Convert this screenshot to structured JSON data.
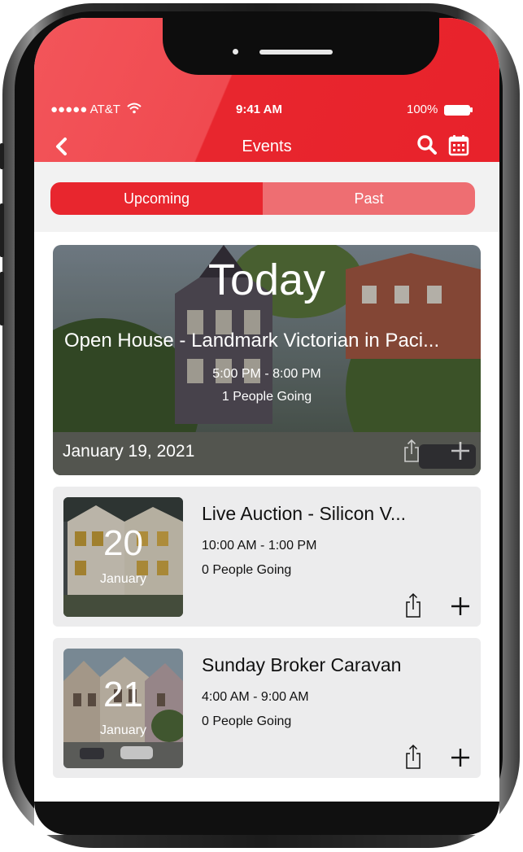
{
  "status_bar": {
    "carrier": "●●●●● AT&T",
    "time": "9:41 AM",
    "battery": "100%"
  },
  "header": {
    "title": "Events",
    "back_icon": "chevron-left-icon",
    "search_icon": "search-icon",
    "calendar_icon": "calendar-icon"
  },
  "tabs": [
    {
      "label": "Upcoming",
      "active": true
    },
    {
      "label": "Past",
      "active": false
    }
  ],
  "featured_event": {
    "heading": "Today",
    "title": "Open House - Landmark Victorian in Paci...",
    "time": "5:00 PM - 8:00 PM",
    "going": "1 People Going",
    "date": "January 19, 2021"
  },
  "events": [
    {
      "day": "20",
      "month": "January",
      "title": "Live Auction - Silicon V...",
      "time": "10:00 AM - 1:00 PM",
      "going": "0 People Going"
    },
    {
      "day": "21",
      "month": "January",
      "title": "Sunday Broker Caravan",
      "time": "4:00 AM - 9:00 AM",
      "going": "0 People Going"
    }
  ],
  "colors": {
    "brand_red": "#e8262e",
    "tab_inactive": "#ee6e72",
    "card_bg": "#ececed"
  }
}
